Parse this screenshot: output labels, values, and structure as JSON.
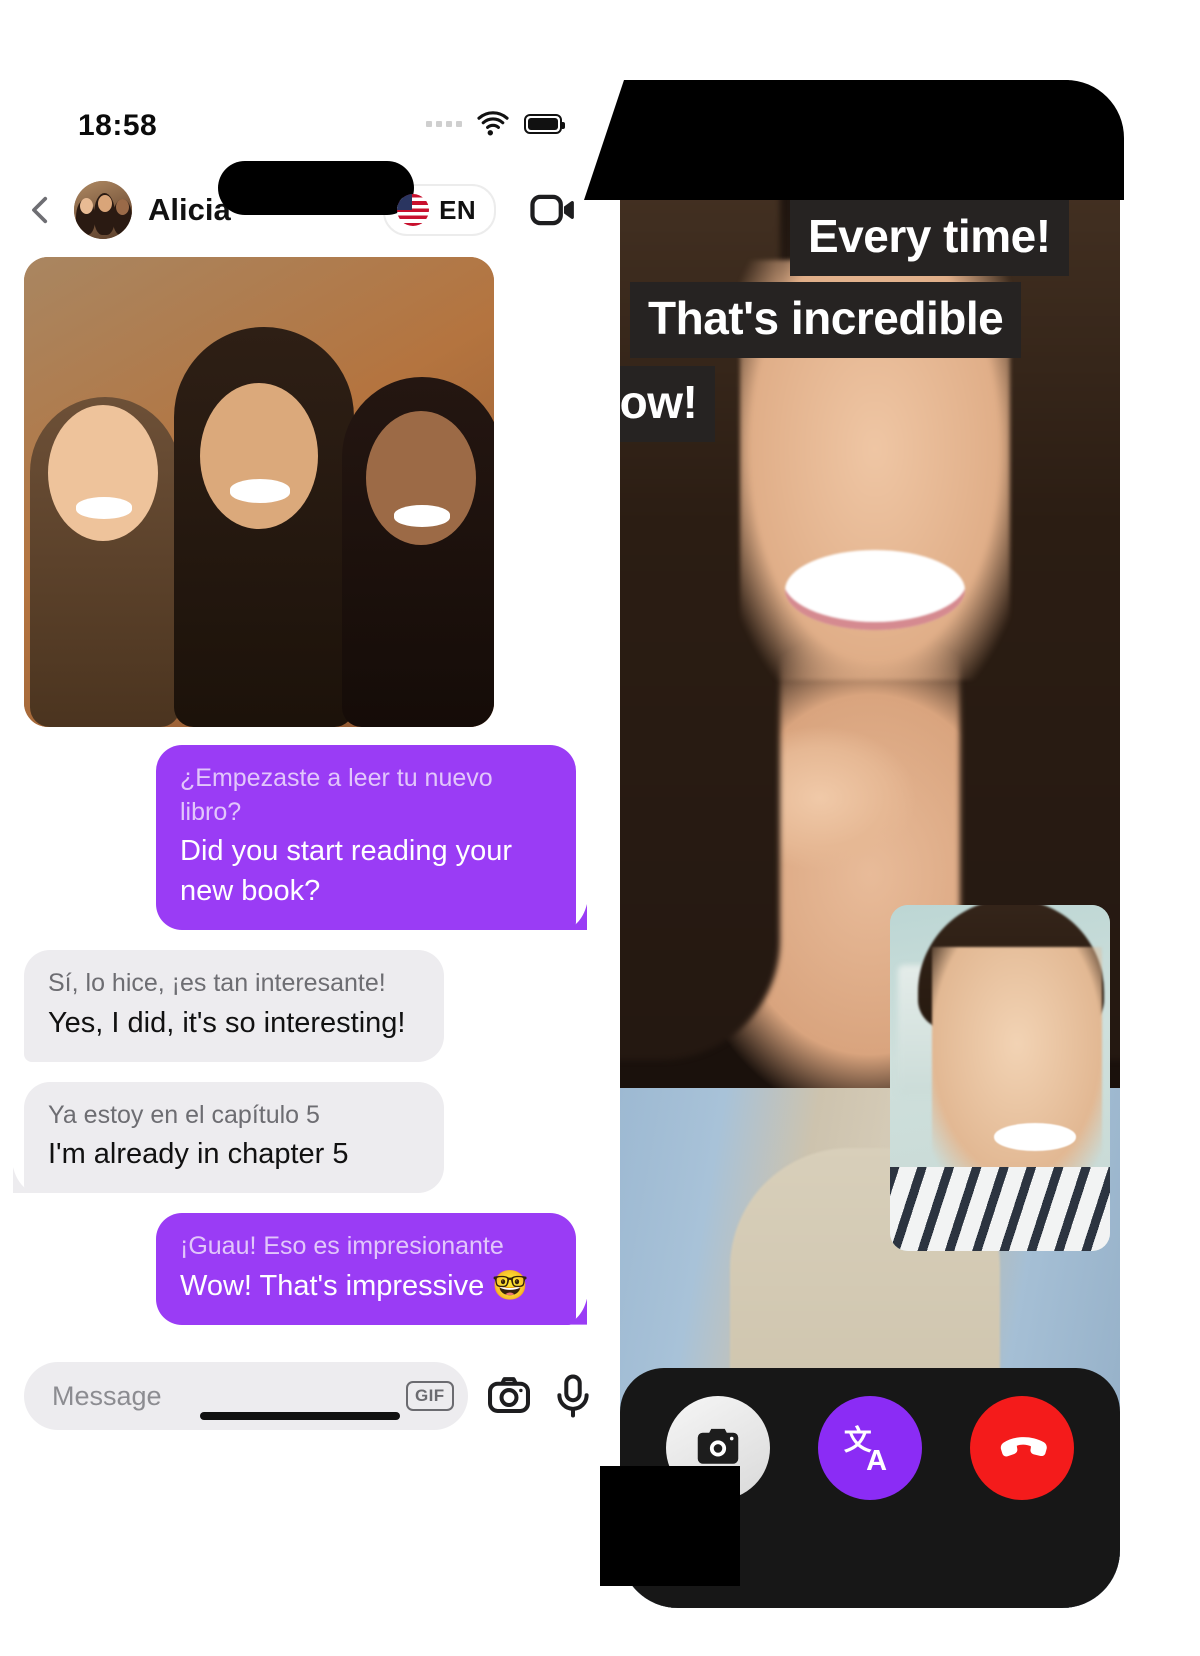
{
  "left_phone": {
    "status_bar": {
      "time": "18:58",
      "signal_icon": "signal-dots-icon",
      "wifi_icon": "wifi-icon",
      "battery_icon": "battery-icon"
    },
    "header": {
      "back_icon": "back-chevron-icon",
      "avatar_icon": "contact-avatar",
      "contact_name": "Alicia",
      "language_pill": {
        "flag_icon": "us-flag-icon",
        "code": "EN"
      },
      "video_call_icon": "video-camera-icon"
    },
    "messages": [
      {
        "type": "photo",
        "direction": "in",
        "alt": "three-friends-selfie-photo"
      },
      {
        "type": "text",
        "direction": "out",
        "original": "¿Empezaste a leer tu nuevo libro?",
        "translation": "Did you start reading your new book?"
      },
      {
        "type": "text",
        "direction": "in",
        "original": "Sí, lo hice, ¡es tan interesante!",
        "translation": "Yes, I did, it's so interesting!"
      },
      {
        "type": "text",
        "direction": "in",
        "original": "Ya estoy en el capítulo 5",
        "translation": "I'm already in chapter 5"
      },
      {
        "type": "text",
        "direction": "out",
        "original": "¡Guau! Eso es impresionante",
        "translation": "Wow! That's impressive 🤓"
      }
    ],
    "composer": {
      "input_value": "",
      "placeholder": "Message",
      "gif_label": "GIF",
      "camera_icon": "camera-icon",
      "mic_icon": "microphone-icon"
    }
  },
  "right_phone": {
    "captions": [
      "Every time!",
      "That's incredible",
      "how!"
    ],
    "pip_label": "self-view-video",
    "controls": [
      {
        "name": "camera-button",
        "icon": "camera-icon",
        "color": "#ededed"
      },
      {
        "name": "translate-button",
        "icon": "translate-icon",
        "color": "#8b2cf5"
      },
      {
        "name": "hangup-button",
        "icon": "phone-hangup-icon",
        "color": "#f41b1b"
      }
    ]
  },
  "colors": {
    "accent_purple": "#9a3cf5",
    "control_purple": "#8b2cf5",
    "hangup_red": "#f41b1b",
    "incoming_bubble": "#edecef",
    "caption_bg": "#262322",
    "call_bar_bg": "#171717"
  }
}
